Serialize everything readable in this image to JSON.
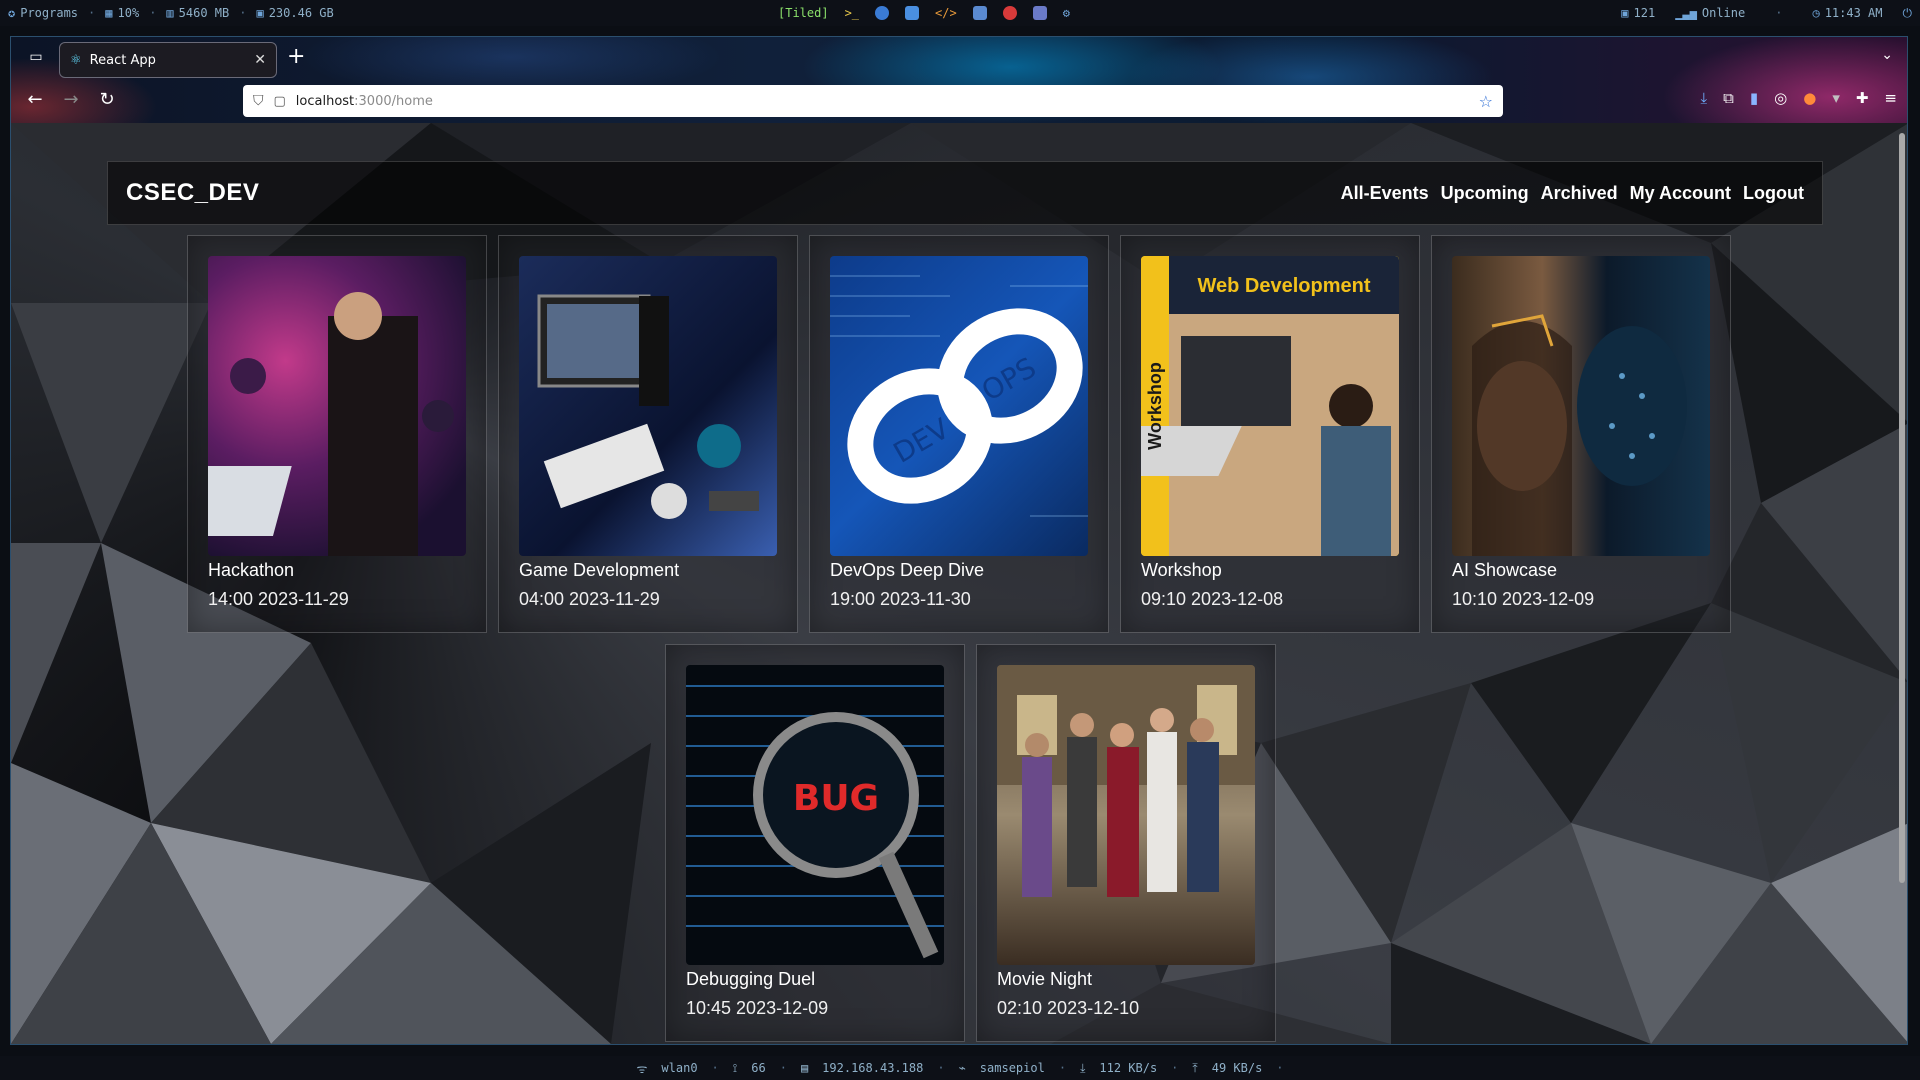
{
  "system_bar": {
    "programs_label": "Programs",
    "cpu": "10%",
    "memory": "5460 MB",
    "disk": "230.46 GB",
    "layout": "[Tiled]",
    "updates": "121",
    "network_status": "Online",
    "clock": "11:43 AM"
  },
  "browser": {
    "tab_title": "React App",
    "url_host": "localhost",
    "url_path": ":3000/home"
  },
  "app": {
    "brand": "CSEC_DEV",
    "nav": [
      "All-Events",
      "Upcoming",
      "Archived",
      "My Account",
      "Logout"
    ]
  },
  "events": [
    {
      "title": "Hackathon",
      "when": "14:00 2023-11-29"
    },
    {
      "title": "Game Development",
      "when": "04:00 2023-11-29"
    },
    {
      "title": "DevOps Deep Dive",
      "when": "19:00 2023-11-30"
    },
    {
      "title": "Workshop",
      "when": "09:10 2023-12-08"
    },
    {
      "title": "AI Showcase",
      "when": "10:10 2023-12-09"
    },
    {
      "title": "Debugging Duel",
      "when": "10:45 2023-12-09"
    },
    {
      "title": "Movie Night",
      "when": "02:10 2023-12-10"
    }
  ],
  "thumb_text": {
    "devops_left": "DEV",
    "devops_right": "OPS",
    "workshop_banner": "Web Development",
    "workshop_side": "Workshop",
    "bug_word": "BUG"
  },
  "status_bar": {
    "interface": "wlan0",
    "signal": "66",
    "ip": "192.168.43.188",
    "ssid": "samsepiol",
    "down": "112 KB/s",
    "up": "49 KB/s"
  }
}
